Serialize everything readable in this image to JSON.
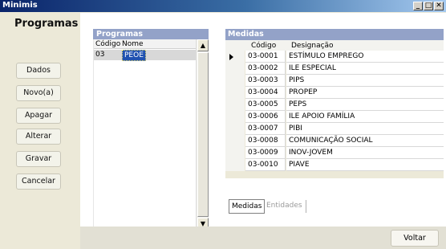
{
  "window": {
    "title": "Minimis",
    "minimize_glyph": "_",
    "maximize_glyph": "□",
    "close_glyph": "✕"
  },
  "sidebar": {
    "heading": "Programas",
    "buttons": [
      {
        "label": "Dados"
      },
      {
        "label": "Novo(a)"
      },
      {
        "label": "Apagar"
      },
      {
        "label": "Alterar"
      },
      {
        "label": "Gravar"
      },
      {
        "label": "Cancelar"
      }
    ]
  },
  "programas": {
    "title": "Programas",
    "columns": [
      "Código",
      "Nome"
    ],
    "rows": [
      {
        "codigo": "03",
        "nome": "PEOE"
      }
    ],
    "scroll_up_glyph": "▲",
    "scroll_down_glyph": "▼"
  },
  "medidas": {
    "title": "Medidas",
    "columns": [
      "Código",
      "Designação"
    ],
    "current_row_glyph": "current-row-arrow",
    "rows": [
      {
        "codigo": "03-0001",
        "designacao": "ESTÍMULO EMPREGO"
      },
      {
        "codigo": "03-0002",
        "designacao": "ILE ESPECIAL"
      },
      {
        "codigo": "03-0003",
        "designacao": "PIPS"
      },
      {
        "codigo": "03-0004",
        "designacao": "PROPEP"
      },
      {
        "codigo": "03-0005",
        "designacao": "PEPS"
      },
      {
        "codigo": "03-0006",
        "designacao": "ILE APOIO FAMÍLIA"
      },
      {
        "codigo": "03-0007",
        "designacao": "PIBI"
      },
      {
        "codigo": "03-0008",
        "designacao": "COMUNICAÇÃO SOCIAL"
      },
      {
        "codigo": "03-0009",
        "designacao": "INOV-JOVEM"
      },
      {
        "codigo": "03-0010",
        "designacao": "PIAVE"
      }
    ]
  },
  "tabs": [
    {
      "label": "Medidas",
      "active": true
    },
    {
      "label": "Entidades",
      "active": false
    }
  ],
  "footer": {
    "back_label": "Voltar"
  },
  "colors": {
    "title_bar_start": "#0a246a",
    "panel_header": "#93a2c8",
    "selection": "#2052b0",
    "background": "#ece9d8"
  }
}
